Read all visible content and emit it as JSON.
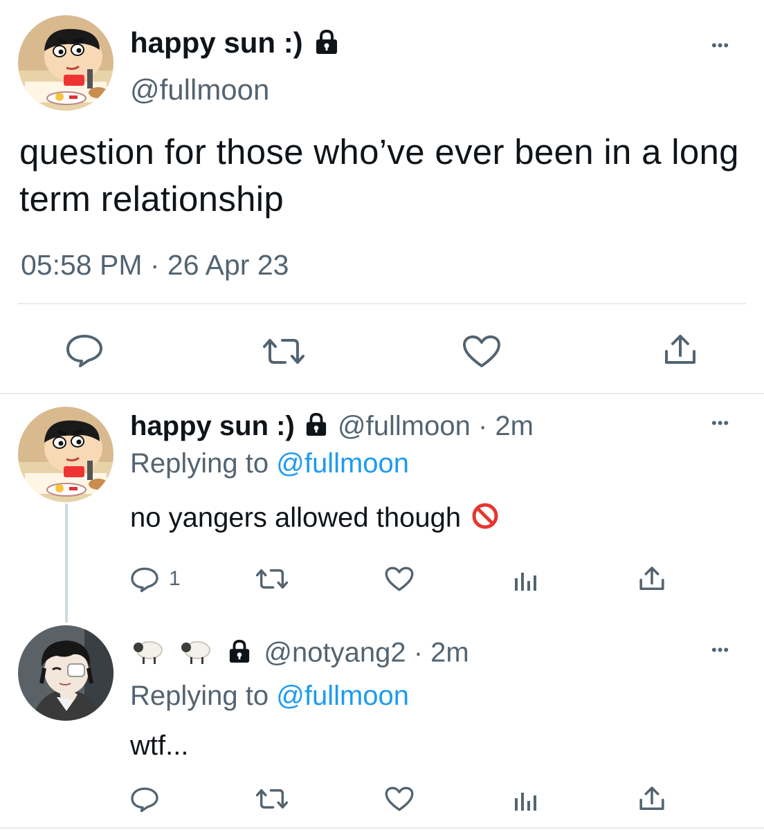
{
  "main_tweet": {
    "display_name": "happy sun :)",
    "lock_icon": "lock-icon",
    "handle": "@fullmoon",
    "text": "question for those who’ve ever been in a long term relationship",
    "timestamp": "05:58 PM · 26 Apr 23",
    "more_label": "•••",
    "actions": [
      "reply-icon",
      "retweet-icon",
      "like-icon",
      "share-icon"
    ]
  },
  "replies": [
    {
      "display_name": "happy sun :)",
      "handle": "@fullmoon",
      "separator": " · ",
      "time": "2m",
      "replying_prefix": "Replying to ",
      "replying_handle": "@fullmoon",
      "text": "no yangers allowed though",
      "emoji": "🚫",
      "reply_count": "1",
      "more_label": "•••"
    },
    {
      "display_name": "🐑🐑",
      "handle": "@notyang2",
      "separator": " · ",
      "time": "2m",
      "replying_prefix": "Replying to ",
      "replying_handle": "@fullmoon",
      "text": "wtf...",
      "reply_count": "",
      "more_label": "•••"
    }
  ],
  "colors": {
    "text": "#0f1419",
    "secondary": "#536471",
    "link": "#1d9bf0",
    "divider": "#e6ecf0"
  }
}
